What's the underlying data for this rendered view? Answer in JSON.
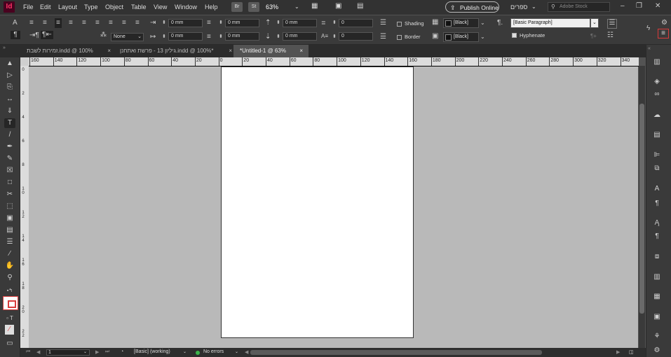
{
  "app": {
    "logo": "Id"
  },
  "menu": [
    "File",
    "Edit",
    "Layout",
    "Type",
    "Object",
    "Table",
    "View",
    "Window",
    "Help"
  ],
  "menubar": {
    "bridge": "Br",
    "stock_btn": "St",
    "zoom": "63%",
    "publish": "Publish Online",
    "workspace": "ספרים",
    "search_placeholder": "Adobe Stock"
  },
  "control": {
    "left_indent": "0 mm",
    "first_indent": "0 mm",
    "right_indent": "0 mm",
    "last_indent": "0 mm",
    "space_before": "0 mm",
    "space_after": "0 mm",
    "drop_lines": "0",
    "drop_chars": "0",
    "numbering": "None",
    "shading_label": "Shading",
    "border_label": "Border",
    "shading_swatch": "[Black]",
    "border_swatch": "[Black]",
    "paragraph_style": "[Basic Paragraph]",
    "hyphenate_label": "Hyphenate"
  },
  "tabs": [
    {
      "label": "זמירות לשבת.indd @ 100%",
      "close": "×"
    },
    {
      "label": "גיליון 13 - פרשת ואתחנן.indd @ 100%*",
      "close": "×"
    },
    {
      "label": "*Untitled-1 @ 63%",
      "close": "×"
    }
  ],
  "ruler_top": [
    "160",
    "140",
    "120",
    "100",
    "80",
    "60",
    "40",
    "20",
    "0",
    "20",
    "40",
    "60",
    "80",
    "100",
    "120",
    "140",
    "160",
    "180",
    "200",
    "220",
    "240",
    "260",
    "280",
    "300",
    "320",
    "340"
  ],
  "ruler_left": [
    "0",
    "2",
    "4",
    "6",
    "8",
    "10",
    "12",
    "14",
    "16",
    "18",
    "20",
    "22"
  ],
  "status": {
    "page": "1",
    "style": "[Basic] (working)",
    "errors": "No errors"
  },
  "colors": {
    "accent_error": "#d83b3b",
    "ok_dot": "#3cb44b",
    "logo_bg": "#49021f"
  }
}
